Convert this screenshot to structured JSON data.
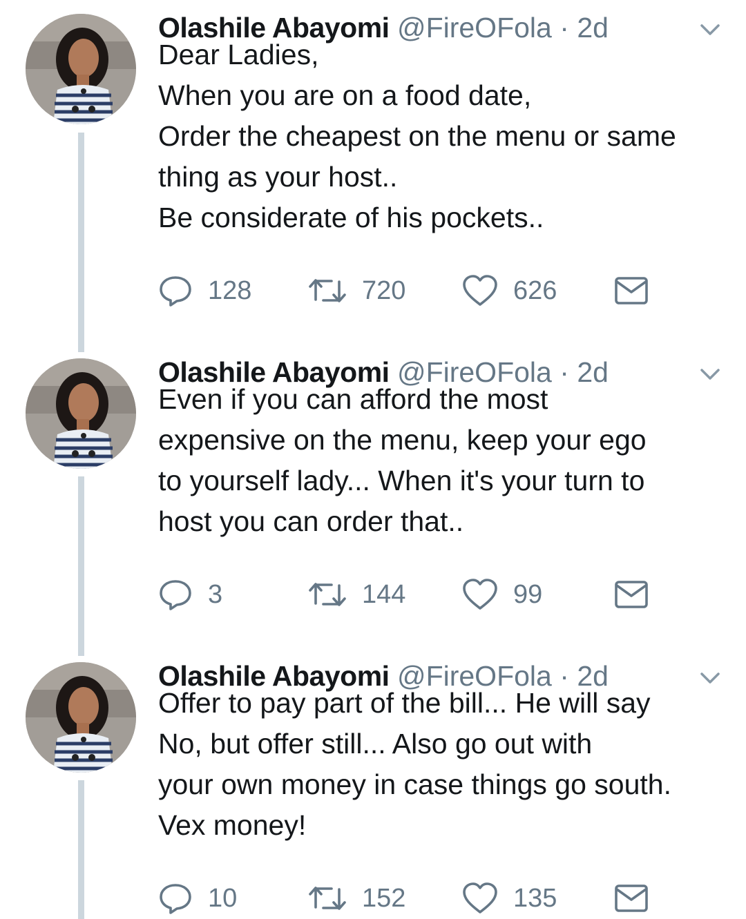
{
  "author": {
    "name": "Olashile Abayomi",
    "handle": "@FireOFola",
    "separator": "·"
  },
  "icons": {
    "reply": "reply-icon",
    "retweet": "retweet-icon",
    "like": "heart-icon",
    "dm": "envelope-icon",
    "menu": "chevron-down-icon"
  },
  "colors": {
    "text": "#14171a",
    "secondary": "#657786",
    "thread_line": "#ccd6dd"
  },
  "tweets": [
    {
      "time": "2d",
      "lines": [
        "Dear Ladies,",
        "When you are on a food date,",
        "Order the cheapest on the menu or same",
        "thing as your host..",
        "Be considerate of his pockets.."
      ],
      "replies": "128",
      "retweets": "720",
      "likes": "626"
    },
    {
      "time": "2d",
      "lines": [
        "Even if you can afford the most",
        "expensive on the menu,  keep your ego",
        "to yourself lady... When it's your turn to",
        "host you can order that.."
      ],
      "replies": "3",
      "retweets": "144",
      "likes": "99"
    },
    {
      "time": "2d",
      "lines": [
        "Offer to pay part of the bill...  He will say",
        "No,  but offer still...  Also go out with",
        "your own money in case things go south.",
        "Vex money!"
      ],
      "replies": "10",
      "retweets": "152",
      "likes": "135"
    }
  ]
}
